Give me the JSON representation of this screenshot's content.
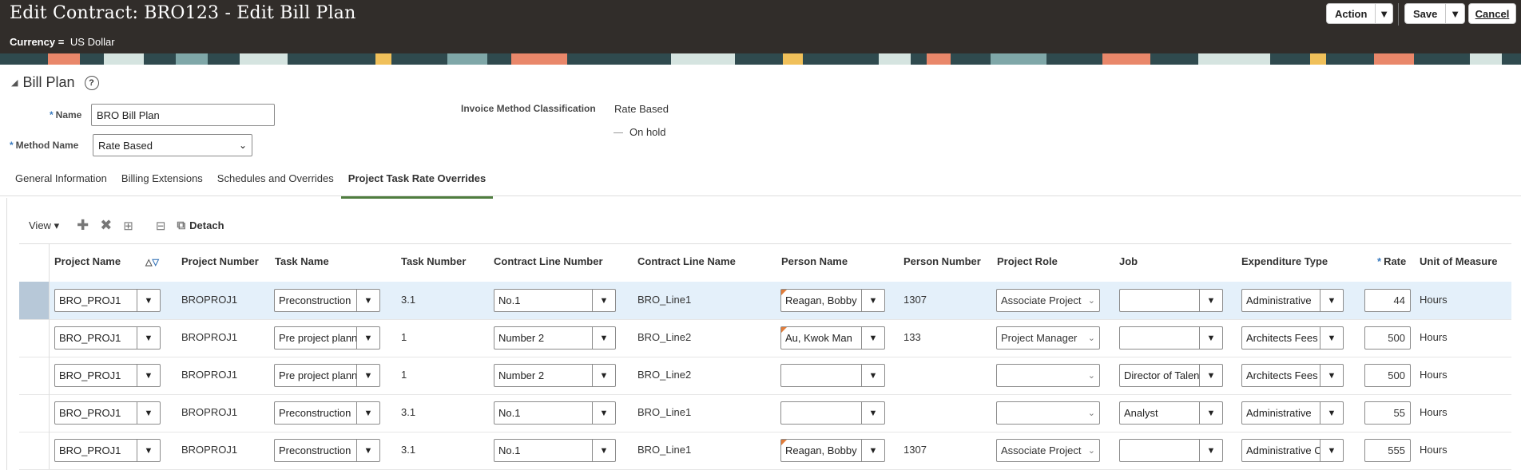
{
  "header": {
    "title": "Edit Contract: BRO123 - Edit Bill Plan",
    "currency_label": "Currency =",
    "currency_value": "US Dollar",
    "action_label": "Action",
    "save_label": "Save",
    "cancel_label": "Cancel"
  },
  "section": {
    "title": "Bill Plan"
  },
  "form": {
    "name_label": "Name",
    "name_value": "BRO Bill Plan",
    "method_label": "Method Name",
    "method_value": "Rate Based",
    "imc_label": "Invoice Method Classification",
    "imc_value": "Rate Based",
    "onhold_label": "On hold"
  },
  "tabs": [
    "General Information",
    "Billing Extensions",
    "Schedules and Overrides",
    "Project Task Rate Overrides"
  ],
  "toolbar": {
    "view_label": "View",
    "detach_label": "Detach"
  },
  "columns": [
    "Project Name",
    "Project Number",
    "Task Name",
    "Task Number",
    "Contract Line Number",
    "Contract Line Name",
    "Person Name",
    "Person Number",
    "Project Role",
    "Job",
    "Expenditure Type",
    "Rate",
    "Unit of Measure"
  ],
  "rows": [
    {
      "project": "BRO_PROJ1",
      "project_number": "BROPROJ1",
      "task": "Preconstruction",
      "task_number": "3.1",
      "line_number": "No.1",
      "line_name": "BRO_Line1",
      "person": "Reagan, Bobby",
      "person_number": "1307",
      "role": "Associate Project",
      "job": "",
      "exp_type": "Administrative",
      "rate": "44",
      "uom": "Hours"
    },
    {
      "project": "BRO_PROJ1",
      "project_number": "BROPROJ1",
      "task": "Pre project plann",
      "task_number": "1",
      "line_number": "Number 2",
      "line_name": "BRO_Line2",
      "person": "Au, Kwok Man",
      "person_number": "133",
      "role": "Project Manager",
      "job": "",
      "exp_type": "Architects Fees",
      "rate": "500",
      "uom": "Hours"
    },
    {
      "project": "BRO_PROJ1",
      "project_number": "BROPROJ1",
      "task": "Pre project plann",
      "task_number": "1",
      "line_number": "Number 2",
      "line_name": "BRO_Line2",
      "person": "",
      "person_number": "",
      "role": "",
      "job": "Director of Talen",
      "exp_type": "Architects Fees",
      "rate": "500",
      "uom": "Hours"
    },
    {
      "project": "BRO_PROJ1",
      "project_number": "BROPROJ1",
      "task": "Preconstruction",
      "task_number": "3.1",
      "line_number": "No.1",
      "line_name": "BRO_Line1",
      "person": "",
      "person_number": "",
      "role": "",
      "job": "Analyst",
      "exp_type": "Administrative",
      "rate": "55",
      "uom": "Hours"
    },
    {
      "project": "BRO_PROJ1",
      "project_number": "BROPROJ1",
      "task": "Preconstruction",
      "task_number": "3.1",
      "line_number": "No.1",
      "line_name": "BRO_Line1",
      "person": "Reagan, Bobby",
      "person_number": "1307",
      "role": "Associate Project",
      "job": "",
      "exp_type": "Administrative C",
      "rate": "555",
      "uom": "Hours"
    }
  ]
}
